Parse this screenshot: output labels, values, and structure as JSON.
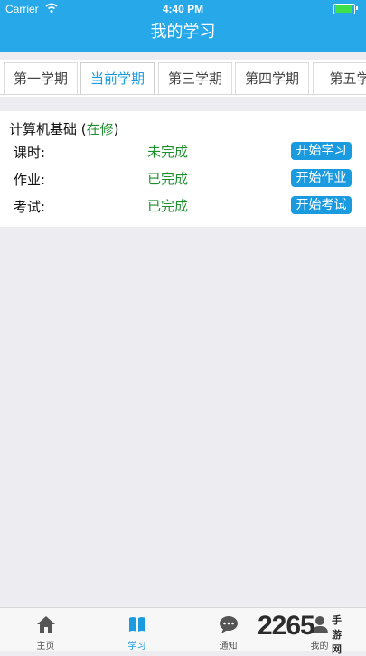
{
  "status": {
    "carrier": "Carrier",
    "time": "4:40 PM"
  },
  "nav": {
    "title": "我的学习"
  },
  "tabs": [
    {
      "label": "第一学期"
    },
    {
      "label": "当前学期",
      "active": true
    },
    {
      "label": "第三学期"
    },
    {
      "label": "第四学期"
    },
    {
      "label": "第五学"
    }
  ],
  "course": {
    "name": "计算机基础 (",
    "status": "在修",
    "close": ")",
    "rows": [
      {
        "label": "课时:",
        "state": "未完成",
        "button": "开始学习"
      },
      {
        "label": "作业:",
        "state": "已完成",
        "button": "开始作业"
      },
      {
        "label": "考试:",
        "state": "已完成",
        "button": "开始考试"
      }
    ]
  },
  "tabbar": [
    {
      "label": "主页",
      "icon": "home-icon"
    },
    {
      "label": "学习",
      "icon": "book-icon",
      "active": true
    },
    {
      "label": "通知",
      "icon": "chat-icon"
    },
    {
      "label": "我的",
      "icon": "user-icon"
    }
  ],
  "watermark": {
    "text": "2265",
    "sub": "手游网"
  },
  "colors": {
    "accent": "#1a9be0",
    "header": "#27a8e8",
    "done": "#1f8f2f"
  }
}
